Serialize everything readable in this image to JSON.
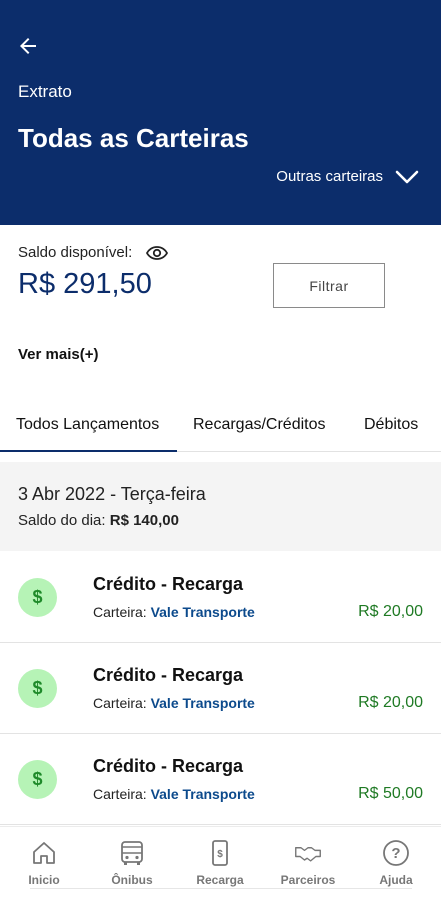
{
  "header": {
    "back_icon": "arrow-left-icon",
    "subtitle": "Extrato",
    "title": "Todas as Carteiras",
    "wallet_selector_label": "Outras carteiras",
    "wallet_selector_icon": "chevron-down-icon",
    "background_color": "#0c2d6b"
  },
  "balance": {
    "label": "Saldo disponível:",
    "visibility_icon": "eye-icon",
    "value": "R$ 291,50",
    "filter_label": "Filtrar",
    "see_more_label": "Ver mais(+)"
  },
  "tabs": [
    {
      "label": "Todos Lançamentos",
      "active": true
    },
    {
      "label": "Recargas/Créditos",
      "active": false
    },
    {
      "label": "Débitos",
      "active": false
    }
  ],
  "day_group": {
    "date": "3 Abr 2022 - Terça-feira",
    "balance_label": "Saldo do dia:",
    "balance_value": "R$ 140,00"
  },
  "transactions": [
    {
      "icon": "dollar-icon",
      "icon_text": "$",
      "title": "Crédito - Recarga",
      "wallet_label": "Carteira:",
      "wallet_name": "Vale Transporte",
      "amount": "R$ 20,00"
    },
    {
      "icon": "dollar-icon",
      "icon_text": "$",
      "title": "Crédito - Recarga",
      "wallet_label": "Carteira:",
      "wallet_name": "Vale Transporte",
      "amount": "R$ 20,00"
    },
    {
      "icon": "dollar-icon",
      "icon_text": "$",
      "title": "Crédito - Recarga",
      "wallet_label": "Carteira:",
      "wallet_name": "Vale Transporte",
      "amount": "R$ 50,00"
    }
  ],
  "bottom_nav": [
    {
      "label": "Inicio",
      "icon": "home-icon"
    },
    {
      "label": "Ônibus",
      "icon": "bus-icon"
    },
    {
      "label": "Recarga",
      "icon": "phone-recharge-icon"
    },
    {
      "label": "Parceiros",
      "icon": "handshake-icon"
    },
    {
      "label": "Ajuda",
      "icon": "help-icon"
    }
  ],
  "colors": {
    "primary": "#0c2d6b",
    "credit_green": "#1f7a24",
    "icon_bg_green": "#b6f3b6",
    "wallet_link": "#0c4a8c"
  }
}
